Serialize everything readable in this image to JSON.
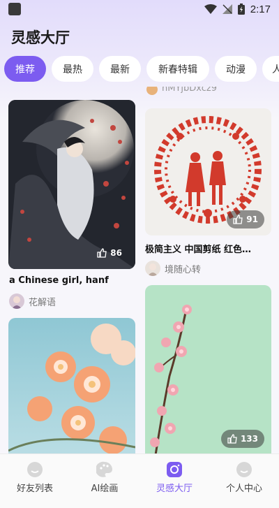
{
  "status_bar": {
    "time": "2:17"
  },
  "header": {
    "title": "灵感大厅"
  },
  "tabs": [
    {
      "label": "推荐",
      "active": true
    },
    {
      "label": "最热",
      "active": false
    },
    {
      "label": "最新",
      "active": false
    },
    {
      "label": "新春特辑",
      "active": false
    },
    {
      "label": "动漫",
      "active": false
    },
    {
      "label": "人",
      "active": false
    }
  ],
  "cards": {
    "left_1": {
      "likes": "86",
      "title": "a Chinese girl, hanf",
      "author": "花解语"
    },
    "left_2": {
      "image": "peach-blossoms-sky"
    },
    "right_0": {
      "author_partial": "hMYjbDxcz9"
    },
    "right_1": {
      "likes": "91",
      "title": "极简主义 中国剪纸 红色…",
      "author": "境随心转"
    },
    "right_2": {
      "likes": "133"
    }
  },
  "bottom_nav": [
    {
      "label": "好友列表",
      "icon": "face-icon",
      "active": false
    },
    {
      "label": "AI绘画",
      "icon": "palette-icon",
      "active": false
    },
    {
      "label": "灵感大厅",
      "icon": "camera-icon",
      "active": true
    },
    {
      "label": "个人中心",
      "icon": "face-icon",
      "active": false
    }
  ],
  "colors": {
    "accent": "#7c5cf0",
    "background": "#f7f6fb"
  }
}
